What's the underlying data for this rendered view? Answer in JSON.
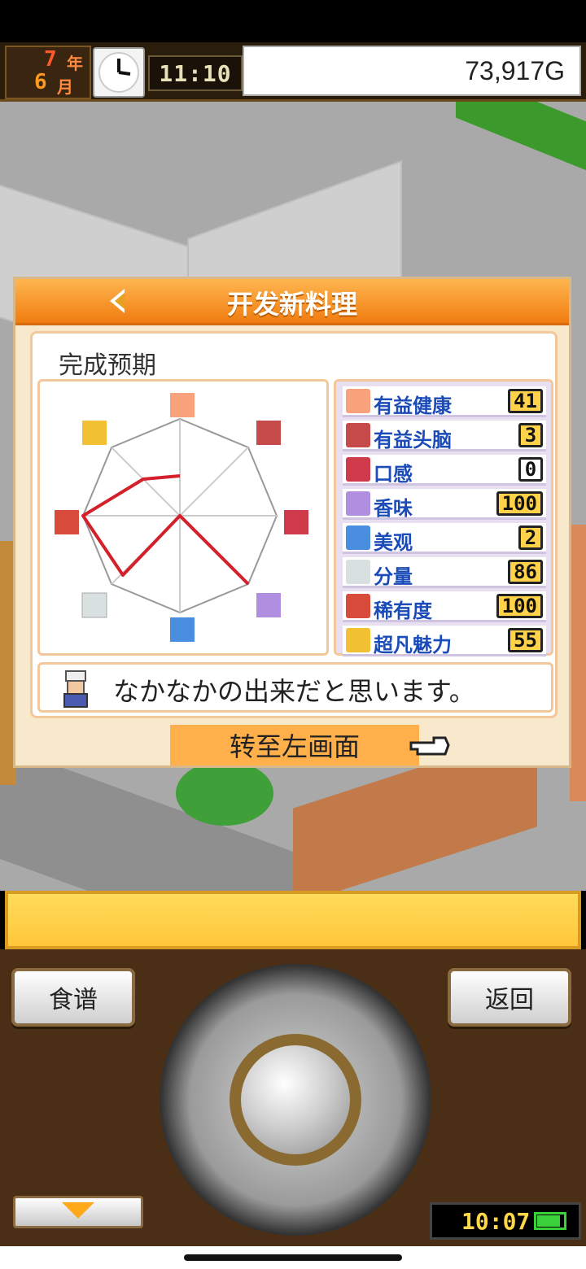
{
  "hud": {
    "year_num": "7",
    "year_kanji": "年",
    "month_num": "6",
    "month_kanji": "月",
    "time": "11:10",
    "money": "73,917G"
  },
  "panel": {
    "title": "开发新料理",
    "section_title": "完成预期",
    "stats": [
      {
        "label": "有益健康",
        "value": "41",
        "icon": "muscle-icon",
        "color": "#f7a27a"
      },
      {
        "label": "有益头脑",
        "value": "3",
        "icon": "brain-icon",
        "color": "#c74a4a"
      },
      {
        "label": "口感",
        "value": "0",
        "icon": "teeth-icon",
        "color": "#cf3b4b"
      },
      {
        "label": "香味",
        "value": "100",
        "icon": "aroma-icon",
        "color": "#b08ee0"
      },
      {
        "label": "美观",
        "value": "2",
        "icon": "sparkle-icon",
        "color": "#4a8ee0"
      },
      {
        "label": "分量",
        "value": "86",
        "icon": "rice-icon",
        "color": "#d8e0e0"
      },
      {
        "label": "稀有度",
        "value": "100",
        "icon": "treasure-icon",
        "color": "#d84a3a"
      },
      {
        "label": "超凡魅力",
        "value": "55",
        "icon": "crown-icon",
        "color": "#f2c033"
      }
    ],
    "comment": "なかなかの出来だと思います。",
    "turn_label": "转至左画面"
  },
  "controls": {
    "recipe_label": "食谱",
    "back_label": "返回",
    "system_time": "10:07"
  }
}
